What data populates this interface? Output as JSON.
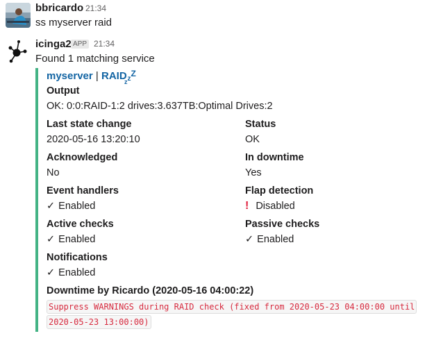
{
  "messages": [
    {
      "username": "bbricardo",
      "time": "21:34",
      "text": "ss myserver raid"
    },
    {
      "username": "icinga2",
      "badge": "APP",
      "time": "21:34",
      "text": "Found 1 matching service",
      "attachment": {
        "accent_color": "#44b385",
        "host_link": "myserver",
        "separator": "|",
        "service_link": "RAID",
        "snooze_icon": "zzz-icon",
        "output_title": "Output",
        "output_value": "OK: 0:0:RAID-1:2 drives:3.637TB:Optimal Drives:2",
        "fields": {
          "last_state_change": {
            "title": "Last state change",
            "value": "2020-05-16 13:20:10"
          },
          "status": {
            "title": "Status",
            "value": "OK"
          },
          "acknowledged": {
            "title": "Acknowledged",
            "value": "No"
          },
          "in_downtime": {
            "title": "In downtime",
            "value": "Yes"
          },
          "event_handlers": {
            "title": "Event handlers",
            "value": "Enabled",
            "icon": "checkmark-icon"
          },
          "flap_detection": {
            "title": "Flap detection",
            "value": "Disabled",
            "icon": "exclamation-icon"
          },
          "active_checks": {
            "title": "Active checks",
            "value": "Enabled",
            "icon": "checkmark-icon"
          },
          "passive_checks": {
            "title": "Passive checks",
            "value": "Enabled",
            "icon": "checkmark-icon"
          },
          "notifications": {
            "title": "Notifications",
            "value": "Enabled",
            "icon": "checkmark-icon"
          }
        },
        "downtime_title": "Downtime by Ricardo (2020-05-16 04:00:22)",
        "downtime_line1": "Suppress WARNINGS during RAID check (fixed from 2020-05-23 04:00:00 until",
        "downtime_line2": "2020-05-23 13:00:00)"
      }
    }
  ],
  "glyphs": {
    "check": "✓",
    "bang": "❗"
  },
  "colors": {
    "link": "#1264a3",
    "code_text": "#d72b3f",
    "alert": "#e01e3c"
  }
}
